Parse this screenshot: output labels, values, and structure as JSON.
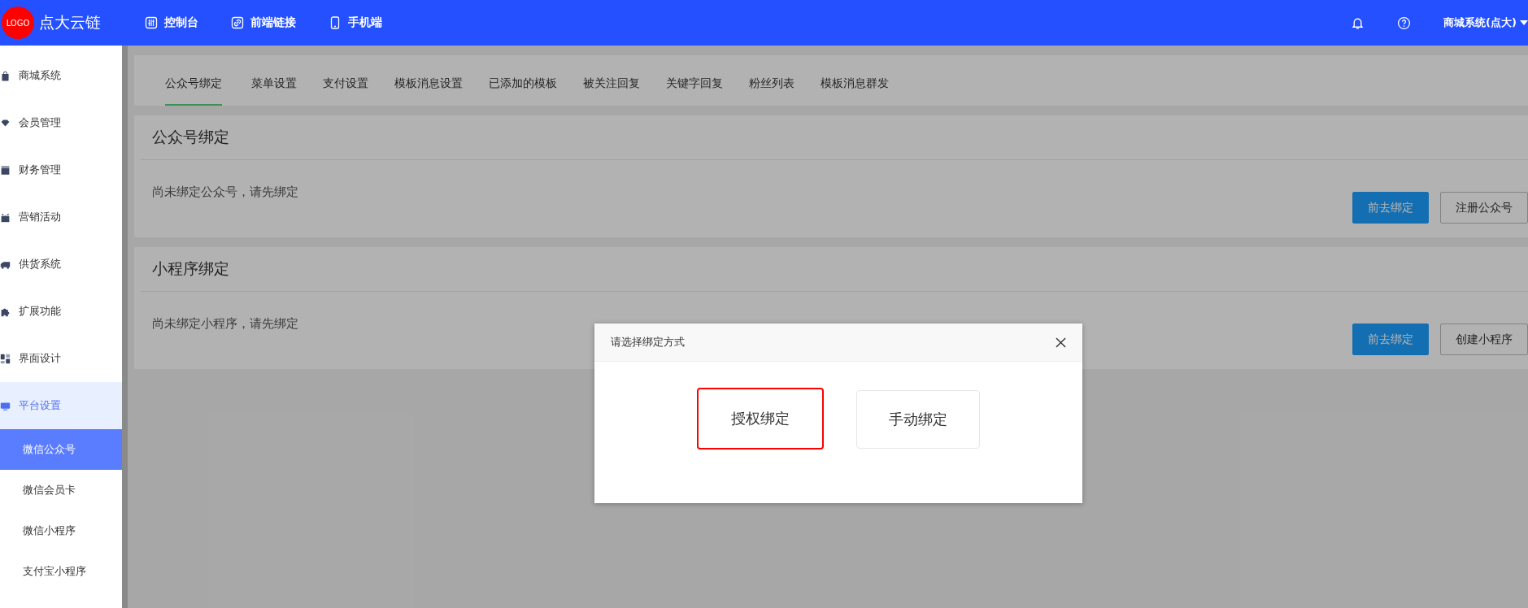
{
  "header": {
    "logo_badge": "LOGO",
    "brand": "点大云链",
    "nav": [
      {
        "label": "控制台"
      },
      {
        "label": "前端链接"
      },
      {
        "label": "手机端"
      }
    ],
    "account": "商城系统(点大)"
  },
  "sidebar": {
    "items": [
      {
        "label": "商城系统",
        "selected": false
      },
      {
        "label": "会员管理",
        "selected": false
      },
      {
        "label": "财务管理",
        "selected": false
      },
      {
        "label": "营销活动",
        "selected": false
      },
      {
        "label": "供货系统",
        "selected": false
      },
      {
        "label": "扩展功能",
        "selected": false
      },
      {
        "label": "界面设计",
        "selected": false
      },
      {
        "label": "平台设置",
        "selected": true,
        "expanded": true,
        "children": [
          {
            "label": "微信公众号",
            "selected": true
          },
          {
            "label": "微信会员卡",
            "selected": false
          },
          {
            "label": "微信小程序",
            "selected": false
          },
          {
            "label": "支付宝小程序",
            "selected": false
          }
        ]
      }
    ]
  },
  "tabs": [
    {
      "label": "公众号绑定",
      "selected": true
    },
    {
      "label": "菜单设置",
      "selected": false
    },
    {
      "label": "支付设置",
      "selected": false
    },
    {
      "label": "模板消息设置",
      "selected": false
    },
    {
      "label": "已添加的模板",
      "selected": false
    },
    {
      "label": "被关注回复",
      "selected": false
    },
    {
      "label": "关键字回复",
      "selected": false
    },
    {
      "label": "粉丝列表",
      "selected": false
    },
    {
      "label": "模板消息群发",
      "selected": false
    }
  ],
  "sections": [
    {
      "title": "公众号绑定",
      "message": "尚未绑定公众号，请先绑定",
      "buttons": [
        {
          "label": "前去绑定",
          "kind": "primary"
        },
        {
          "label": "注册公众号",
          "kind": "default"
        }
      ]
    },
    {
      "title": "小程序绑定",
      "message": "尚未绑定小程序，请先绑定",
      "buttons": [
        {
          "label": "前去绑定",
          "kind": "primary"
        },
        {
          "label": "创建小程序",
          "kind": "default"
        }
      ]
    }
  ],
  "dialog": {
    "title": "请选择绑定方式",
    "options": [
      {
        "label": "授权绑定",
        "selected": true
      },
      {
        "label": "手动绑定",
        "selected": false
      }
    ]
  }
}
